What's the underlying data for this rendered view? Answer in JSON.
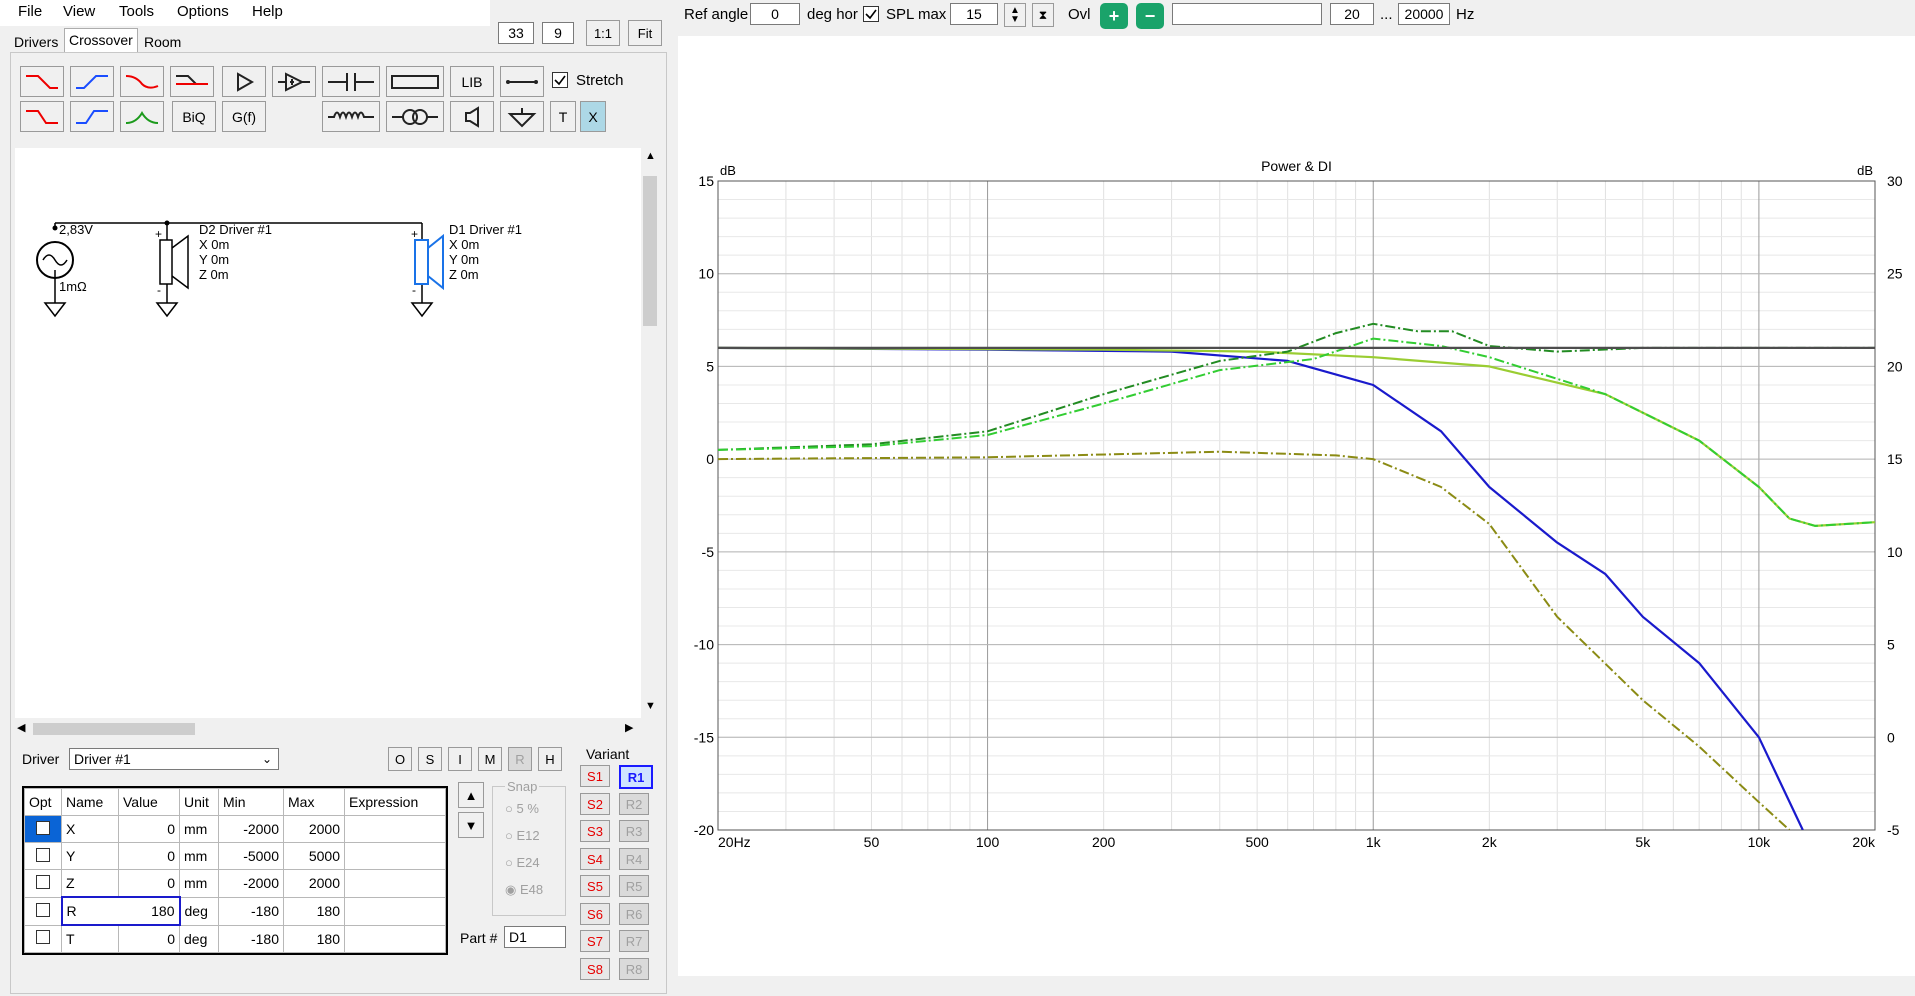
{
  "menu": [
    "File",
    "View",
    "Tools",
    "Options",
    "Help"
  ],
  "zoom": {
    "value1": "33",
    "value2": "9",
    "btn_1to1": "1:1",
    "btn_fit": "Fit"
  },
  "tabs": [
    "Drivers",
    "Crossover",
    "Room"
  ],
  "toolbar": {
    "lib": "LIB",
    "biq": "BiQ",
    "gf": "G(f)",
    "t": "T",
    "x": "X",
    "stretch": "Stretch"
  },
  "schematic": {
    "source_voltage": "2,83V",
    "source_res": "1mΩ",
    "d2": {
      "name": "D2 Driver #1",
      "x": "X 0m",
      "y": "Y 0m",
      "z": "Z 0m"
    },
    "d1": {
      "name": "D1 Driver #1",
      "x": "X 0m",
      "y": "Y 0m",
      "z": "Z 0m"
    }
  },
  "driver_select": {
    "label": "Driver",
    "value": "Driver #1"
  },
  "osimrh": [
    "O",
    "S",
    "I",
    "M",
    "R",
    "H"
  ],
  "params": {
    "headers": [
      "Opt",
      "Name",
      "Value",
      "Unit",
      "Min",
      "Max",
      "Expression"
    ],
    "rows": [
      {
        "name": "X",
        "value": "0",
        "unit": "mm",
        "min": "-2000",
        "max": "2000"
      },
      {
        "name": "Y",
        "value": "0",
        "unit": "mm",
        "min": "-5000",
        "max": "5000"
      },
      {
        "name": "Z",
        "value": "0",
        "unit": "mm",
        "min": "-2000",
        "max": "2000"
      },
      {
        "name": "R",
        "value": "180",
        "unit": "deg",
        "min": "-180",
        "max": "180"
      },
      {
        "name": "T",
        "value": "0",
        "unit": "deg",
        "min": "-180",
        "max": "180"
      }
    ]
  },
  "snap": {
    "title": "Snap",
    "options": [
      "5 %",
      "E12",
      "E24",
      "E48"
    ]
  },
  "part": {
    "label": "Part #",
    "value": "D1"
  },
  "variant": {
    "title": "Variant",
    "s": [
      "S1",
      "S2",
      "S3",
      "S4",
      "S5",
      "S6",
      "S7",
      "S8"
    ],
    "r": [
      "R1",
      "R2",
      "R3",
      "R4",
      "R5",
      "R6",
      "R7",
      "R8"
    ]
  },
  "chart_toolbar": {
    "ref_angle_label": "Ref angle",
    "ref_angle": "0",
    "deg_hor": "deg hor",
    "spl_max_label": "SPL max",
    "spl_max": "15",
    "ovl": "Ovl",
    "freq_min": "20",
    "ellipsis": "...",
    "freq_max": "20000",
    "hz": "Hz"
  },
  "chart_data": {
    "type": "line",
    "title": "Power & DI",
    "ylabel": "dB",
    "y2label": "dB",
    "xlog": true,
    "xlim": [
      20,
      20000
    ],
    "ylim": [
      -20,
      15
    ],
    "y2lim": [
      -5,
      30
    ],
    "xticks": [
      "20Hz",
      "50",
      "100",
      "200",
      "500",
      "1k",
      "2k",
      "5k",
      "10k",
      "20k"
    ],
    "xtick_values": [
      20,
      50,
      100,
      200,
      500,
      1000,
      2000,
      5000,
      10000,
      20000
    ],
    "yticks": [
      "15",
      "10",
      "5",
      "0",
      "-5",
      "-10",
      "-15",
      "-20"
    ],
    "y2ticks": [
      "30",
      "25",
      "20",
      "15",
      "10",
      "5",
      "0",
      "-5"
    ],
    "grid": true,
    "series": [
      {
        "color": "#1a1acc",
        "style": "solid",
        "axis": "left",
        "x": [
          20,
          100,
          300,
          600,
          1000,
          1500,
          2000,
          3000,
          4000,
          5000,
          7000,
          10000,
          13000
        ],
        "y": [
          6,
          5.9,
          5.8,
          5.3,
          4,
          1.5,
          -1.5,
          -4.5,
          -6.2,
          -8.5,
          -11,
          -15,
          -20
        ]
      },
      {
        "color": "#9acd32",
        "style": "solid",
        "axis": "left",
        "x": [
          20,
          200,
          500,
          1000,
          2000,
          4000,
          7000,
          10000,
          12000,
          14000,
          20000
        ],
        "y": [
          6,
          5.9,
          5.8,
          5.5,
          5,
          3.5,
          1,
          -1.5,
          -3.2,
          -3.6,
          -3.4
        ]
      },
      {
        "color": "#228b22",
        "style": "dashdot",
        "axis": "left",
        "x": [
          20,
          50,
          100,
          200,
          400,
          600,
          800,
          1000,
          1300,
          1600,
          2000,
          3000,
          5000,
          20000
        ],
        "y": [
          0.5,
          0.8,
          1.5,
          3.5,
          5.3,
          5.8,
          6.8,
          7.3,
          6.9,
          6.9,
          6.1,
          5.8,
          6,
          6
        ]
      },
      {
        "color": "#32cd32",
        "style": "dashdot",
        "axis": "left",
        "x": [
          20,
          50,
          100,
          200,
          400,
          700,
          1000,
          1500,
          2000,
          4000,
          7000,
          10000,
          12000,
          14000,
          20000
        ],
        "y": [
          0.5,
          0.7,
          1.3,
          3,
          4.8,
          5.4,
          6.5,
          6.1,
          5.5,
          3.5,
          1,
          -1.5,
          -3.2,
          -3.6,
          -3.4
        ]
      },
      {
        "color": "#8b8b14",
        "style": "dashdot",
        "axis": "left",
        "x": [
          20,
          100,
          400,
          800,
          1000,
          1500,
          2000,
          3000,
          5000,
          7000,
          10000,
          12000
        ],
        "y": [
          0,
          0.1,
          0.4,
          0.2,
          0,
          -1.5,
          -3.5,
          -8.5,
          -13,
          -15.5,
          -18.5,
          -20
        ]
      },
      {
        "color": "#4d4d4d",
        "style": "solid",
        "axis": "left",
        "x": [
          20,
          20000
        ],
        "y": [
          6,
          6
        ]
      }
    ]
  }
}
